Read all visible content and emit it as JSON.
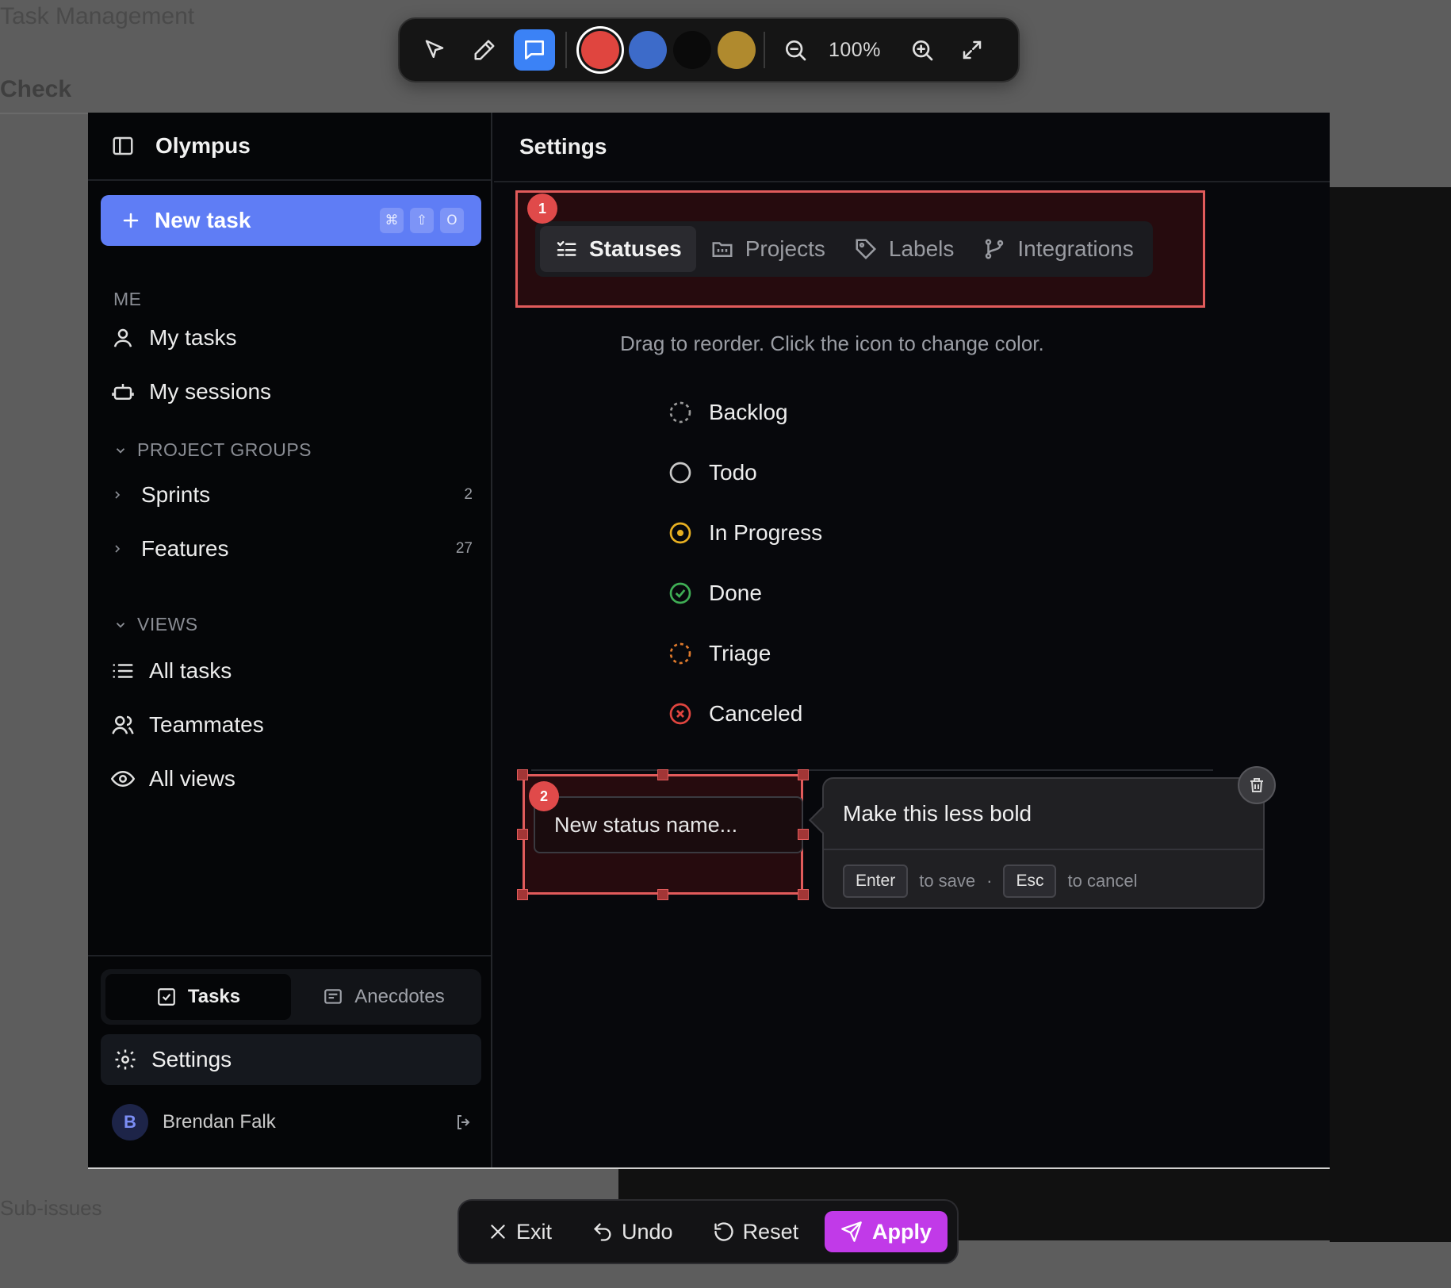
{
  "background": {
    "texts": [
      "Task Management",
      "Check",
      "Sub-issues"
    ]
  },
  "toolbar": {
    "zoom": "100%",
    "colors": [
      "#e0453f",
      "#3d6bc9",
      "#0a0a0a",
      "#b08a2e"
    ],
    "selected_color": "#e0453f",
    "tools": [
      "pointer-icon",
      "pencil-icon",
      "comment-icon",
      "zoom-out-icon",
      "zoom-in-icon",
      "expand-icon"
    ]
  },
  "sidebar": {
    "workspace": "Olympus",
    "new_task": {
      "label": "New task",
      "shortcut": [
        "⌘",
        "⇧",
        "O"
      ]
    },
    "me_label": "ME",
    "me_items": [
      {
        "label": "My tasks",
        "icon": "user-icon"
      },
      {
        "label": "My sessions",
        "icon": "robot-icon"
      }
    ],
    "project_groups_label": "PROJECT GROUPS",
    "project_groups": [
      {
        "label": "Sprints",
        "count": "2"
      },
      {
        "label": "Features",
        "count": "27"
      }
    ],
    "views_label": "VIEWS",
    "views": [
      {
        "label": "All tasks",
        "icon": "list-icon"
      },
      {
        "label": "Teammates",
        "icon": "users-icon"
      },
      {
        "label": "All views",
        "icon": "eye-icon"
      }
    ],
    "modes": [
      {
        "label": "Tasks",
        "active": true
      },
      {
        "label": "Anecdotes",
        "active": false
      }
    ],
    "settings_label": "Settings",
    "user": {
      "initial": "B",
      "name": "Brendan Falk"
    }
  },
  "content": {
    "title": "Settings",
    "tabs": [
      {
        "label": "Statuses",
        "icon": "statuses-icon",
        "active": true
      },
      {
        "label": "Projects",
        "icon": "folder-icon",
        "active": false
      },
      {
        "label": "Labels",
        "icon": "tag-icon",
        "active": false
      },
      {
        "label": "Integrations",
        "icon": "branch-icon",
        "active": false
      }
    ],
    "hint": "Drag to reorder. Click the icon to change color.",
    "statuses": [
      {
        "label": "Backlog",
        "icon": "dashed-circle-icon",
        "color": "#9a9a9a"
      },
      {
        "label": "Todo",
        "icon": "circle-icon",
        "color": "#c8c8c8"
      },
      {
        "label": "In Progress",
        "icon": "progress-icon",
        "color": "#e8b021"
      },
      {
        "label": "Done",
        "icon": "check-circle-icon",
        "color": "#3fae55"
      },
      {
        "label": "Triage",
        "icon": "dashed-circle-icon",
        "color": "#e07a2c"
      },
      {
        "label": "Canceled",
        "icon": "x-circle-icon",
        "color": "#e0453f"
      }
    ],
    "new_status_placeholder": "New status name..."
  },
  "annotations": {
    "badge_1": "1",
    "badge_2": "2",
    "comment": "Make this less bold",
    "save_key": "Enter",
    "save_text": "to save",
    "separator": "·",
    "cancel_key": "Esc",
    "cancel_text": "to cancel"
  },
  "actions": {
    "exit": "Exit",
    "undo": "Undo",
    "reset": "Reset",
    "apply": "Apply"
  }
}
